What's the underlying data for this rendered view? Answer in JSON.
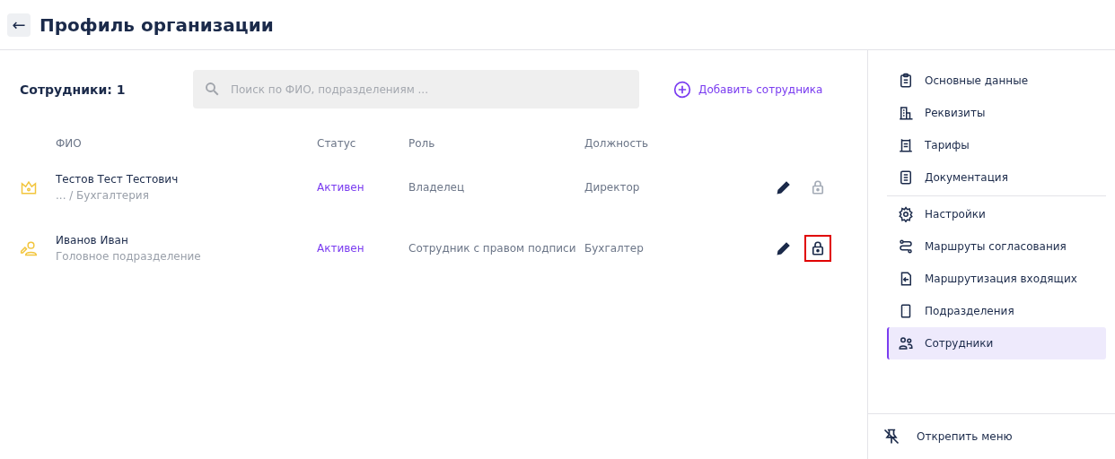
{
  "header": {
    "back_icon": "←",
    "title": "Профиль организации"
  },
  "employees": {
    "count_label": "Сотрудники: 1",
    "search": {
      "placeholder": "Поиск по ФИО, подразделениям ..."
    },
    "add_button": "Добавить сотрудника",
    "table": {
      "columns": [
        "ФИО",
        "Статус",
        "Роль",
        "Должность"
      ],
      "rows": [
        {
          "kind": "owner",
          "name": "Тестов Тест Тестович",
          "department": "... / Бухгалтерия",
          "status": "Активен",
          "role": "Владелец",
          "position": "Директор",
          "lock_disabled": true,
          "highlighted": false
        },
        {
          "kind": "signer",
          "name": "Иванов Иван",
          "department": "Головное подразделение",
          "status": "Активен",
          "role": "Сотрудник с правом подписи",
          "position": "Бухгалтер",
          "lock_disabled": false,
          "highlighted": true
        }
      ]
    }
  },
  "sidebar": {
    "groups": [
      [
        {
          "label": "Основные данные",
          "selected": false
        },
        {
          "label": "Реквизиты",
          "selected": false
        },
        {
          "label": "Тарифы",
          "selected": false
        },
        {
          "label": "Документация",
          "selected": false
        }
      ],
      [
        {
          "label": "Настройки",
          "selected": false
        },
        {
          "label": "Маршруты согласования",
          "selected": false
        },
        {
          "label": "Маршрутизация входящих",
          "selected": false
        },
        {
          "label": "Подразделения",
          "selected": false
        },
        {
          "label": "Сотрудники",
          "selected": true
        }
      ]
    ],
    "footer": "Открепить меню"
  }
}
